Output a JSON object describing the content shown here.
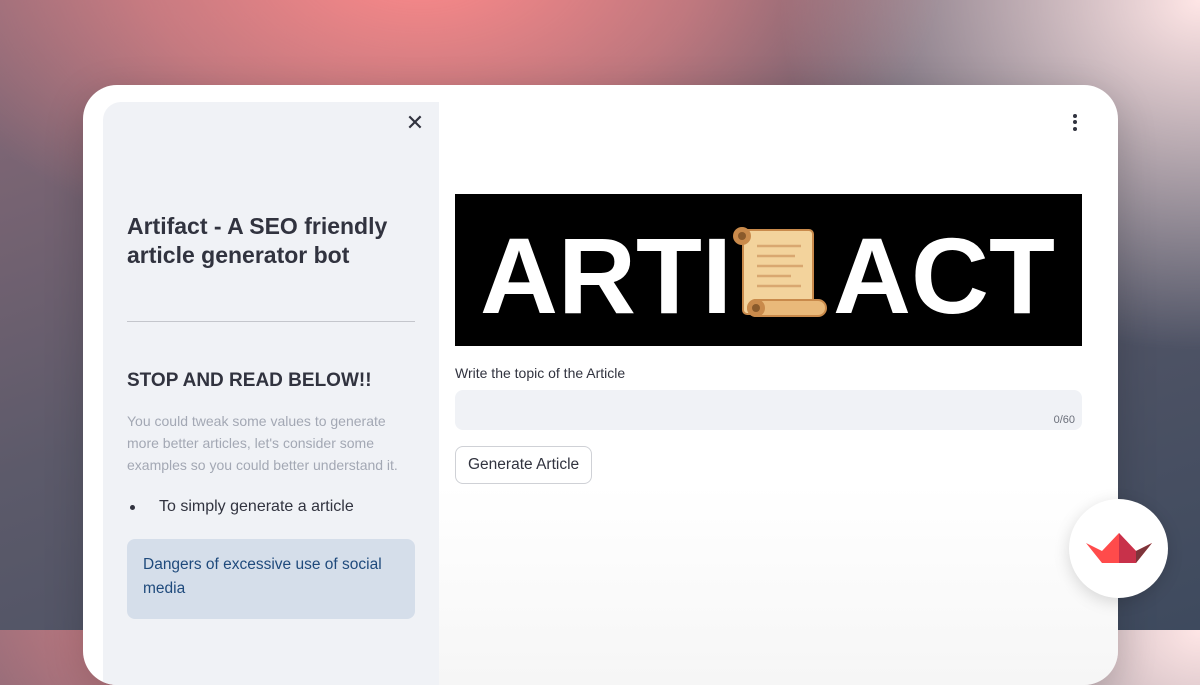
{
  "sidebar": {
    "close_icon": "close-icon",
    "title": "Artifact - A SEO friendly article generator bot",
    "heading": "STOP AND READ BELOW!!",
    "note": "You could tweak some values to generate more better articles, let's consider some examples so you could better understand it.",
    "bullet": "To simply generate a article",
    "info_box": "Dangers of excessive use of social media"
  },
  "main": {
    "menu_icon": "kebab-menu-icon",
    "banner": {
      "text_left": "ARTI",
      "text_right": "ACT",
      "icon": "scroll-icon"
    },
    "input_label": "Write the topic of the Article",
    "input_value": "",
    "char_count": "0/60",
    "generate_button": "Generate Article"
  },
  "badge": {
    "icon": "streamlit-logo-icon"
  },
  "colors": {
    "sidebar_bg": "#f0f2f6",
    "info_bg": "#d5deea",
    "info_text": "#1f4a7c",
    "brand_red": "#ff4b4b"
  }
}
